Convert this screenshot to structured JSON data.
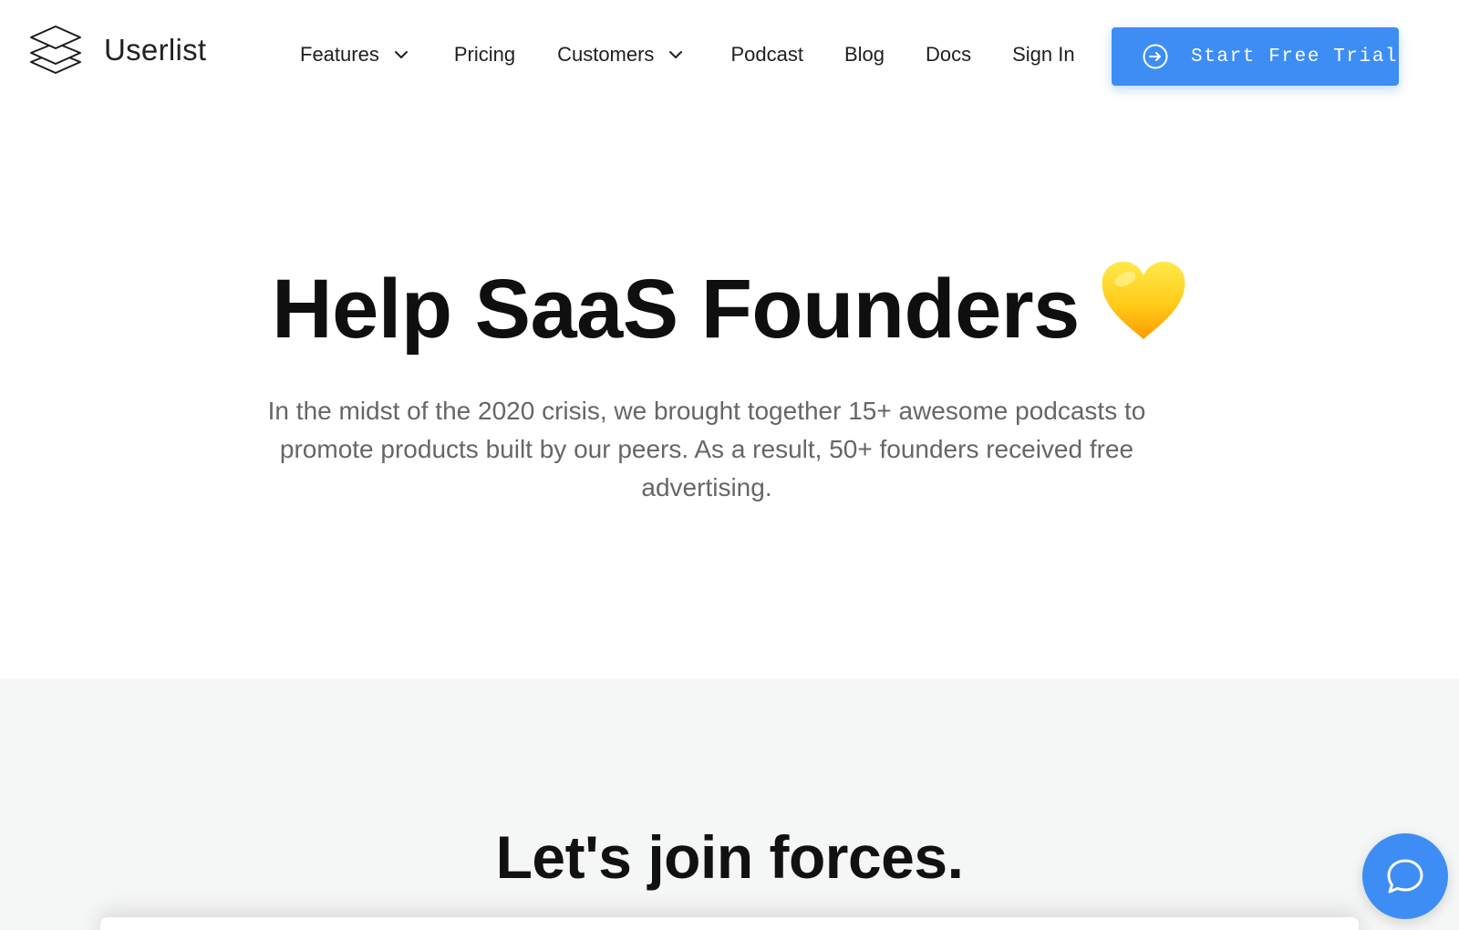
{
  "brand": {
    "name": "Userlist",
    "icon": "stacked-layers-logo"
  },
  "nav": {
    "features": "Features",
    "pricing": "Pricing",
    "customers": "Customers",
    "podcast": "Podcast",
    "blog": "Blog",
    "docs": "Docs",
    "sign_in": "Sign In"
  },
  "cta": {
    "label": "Start Free Trial",
    "icon": "arrow-right-circle-icon",
    "color": "#3d8df5"
  },
  "hero": {
    "title": "Help SaaS Founders",
    "emoji": "yellow-heart",
    "subtitle": "In the midst of the 2020 crisis, we brought together 15+ awesome podcasts to promote products built by our peers. As a result, 50+ founders received free advertising."
  },
  "join": {
    "title": "Let's join forces."
  },
  "chat": {
    "icon": "chat-bubble-icon",
    "color": "#3d8df5"
  }
}
